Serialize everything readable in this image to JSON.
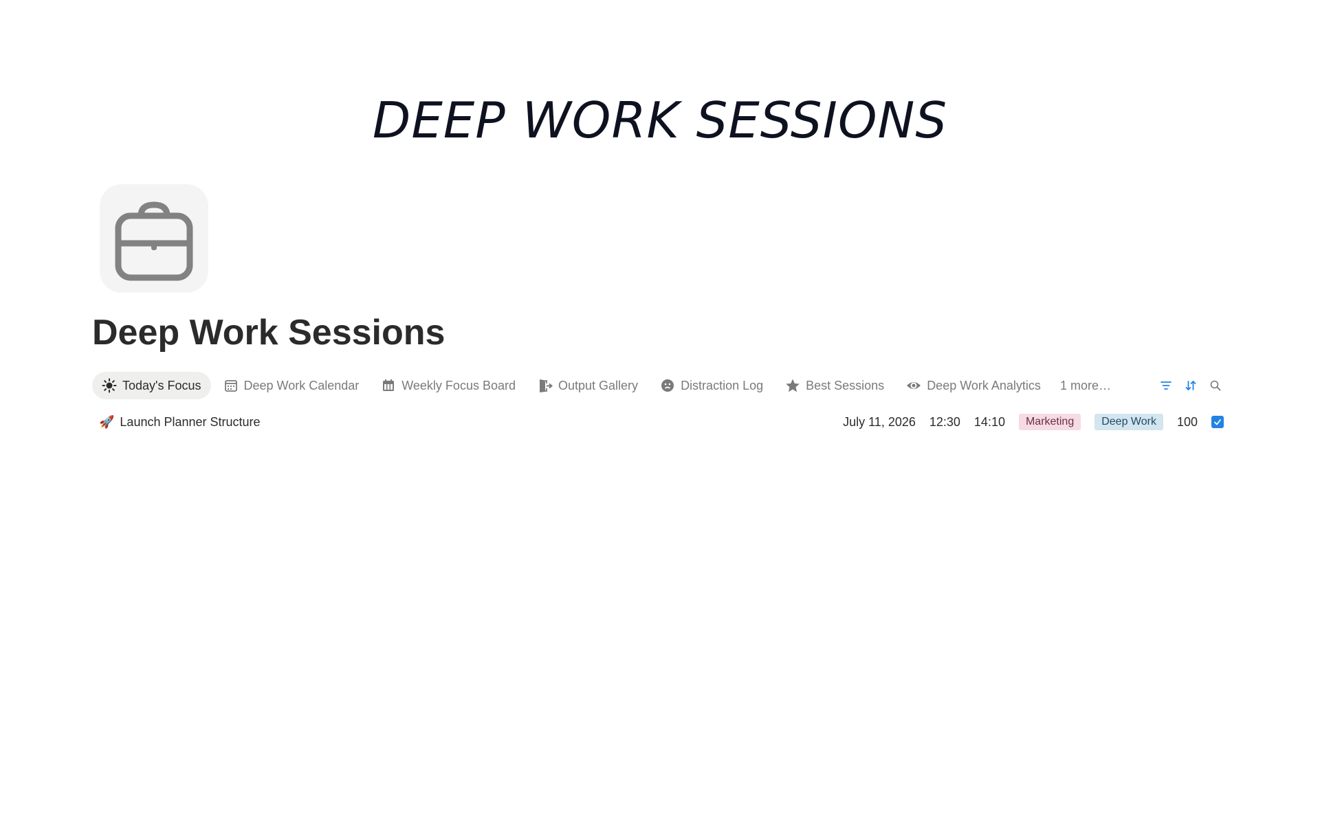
{
  "cover": {
    "title": "DEEP WORK SESSIONS"
  },
  "page": {
    "icon": "briefcase-icon",
    "title": "Deep Work Sessions"
  },
  "tabs": [
    {
      "label": "Today's Focus",
      "icon": "sun-icon",
      "active": true
    },
    {
      "label": "Deep Work Calendar",
      "icon": "calendar-icon"
    },
    {
      "label": "Weekly Focus Board",
      "icon": "calendar-grid-icon"
    },
    {
      "label": "Output Gallery",
      "icon": "door-exit-icon"
    },
    {
      "label": "Distraction Log",
      "icon": "sad-face-icon"
    },
    {
      "label": "Best Sessions",
      "icon": "star-icon"
    },
    {
      "label": "Deep Work Analytics",
      "icon": "eye-icon"
    }
  ],
  "more_label": "1 more…",
  "toolbar": {
    "icons": [
      "filter-icon",
      "sort-icon",
      "search-icon"
    ],
    "accent": "#2383e2"
  },
  "rows": [
    {
      "emoji": "🚀",
      "title": "Launch Planner Structure",
      "date": "July 11, 2026",
      "start": "12:30",
      "end": "14:10",
      "tag1": "Marketing",
      "tag2": "Deep Work",
      "score": "100",
      "checked": true
    }
  ]
}
